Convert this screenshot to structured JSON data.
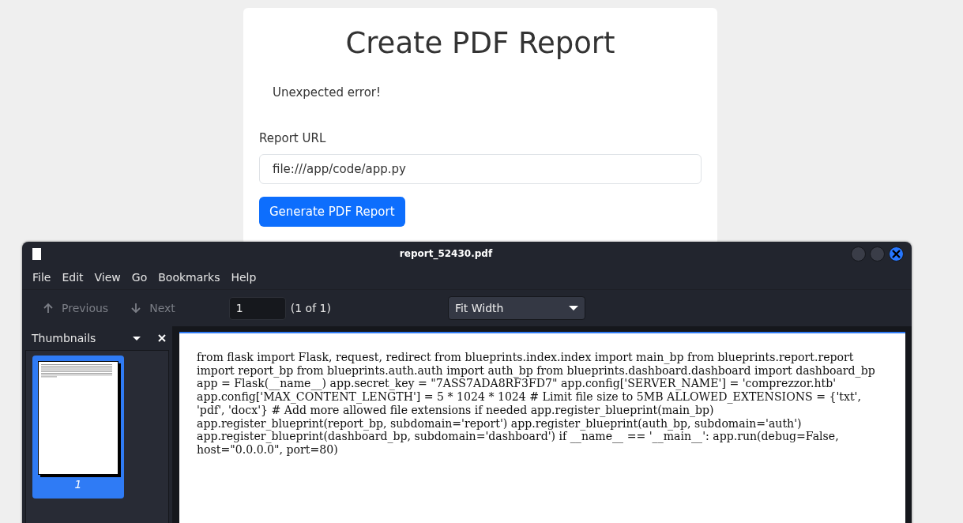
{
  "page": {
    "title": "Create PDF Report",
    "message": "Unexpected error!",
    "field": {
      "label": "Report URL",
      "value": "file:///app/code/app.py"
    },
    "button": "Generate PDF Report"
  },
  "viewer": {
    "title": "report_52430.pdf",
    "menu": [
      "File",
      "Edit",
      "View",
      "Go",
      "Bookmarks",
      "Help"
    ],
    "toolbar": {
      "previous": {
        "label": "Previous",
        "disabled": true
      },
      "next": {
        "label": "Next",
        "disabled": true
      },
      "page": "1",
      "page_count": "(1 of 1)",
      "zoom": "Fit Width"
    },
    "sidebar": {
      "title": "Thumbnails",
      "thumbnails": [
        {
          "label": "1",
          "selected": true
        }
      ]
    },
    "document": {
      "lines": [
        "from flask import Flask, request, redirect from blueprints.index.index import main_bp from blueprints.report.report",
        "import report_bp from blueprints.auth.auth import auth_bp from blueprints.dashboard.dashboard import dashboard_bp",
        "app = Flask(__name__) app.secret_key = \"7ASS7ADA8RF3FD7\" app.config['SERVER_NAME'] = 'comprezzor.htb'",
        "app.config['MAX_CONTENT_LENGTH'] = 5 * 1024 * 1024 # Limit file size to 5MB ALLOWED_EXTENSIONS = {'txt',",
        "'pdf', 'docx'} # Add more allowed file extensions if needed app.register_blueprint(main_bp)",
        "app.register_blueprint(report_bp, subdomain='report') app.register_blueprint(auth_bp, subdomain='auth')",
        "app.register_blueprint(dashboard_bp, subdomain='dashboard') if __name__ == '__main__': app.run(debug=False,",
        "host=\"0.0.0.0\", port=80)"
      ]
    }
  }
}
